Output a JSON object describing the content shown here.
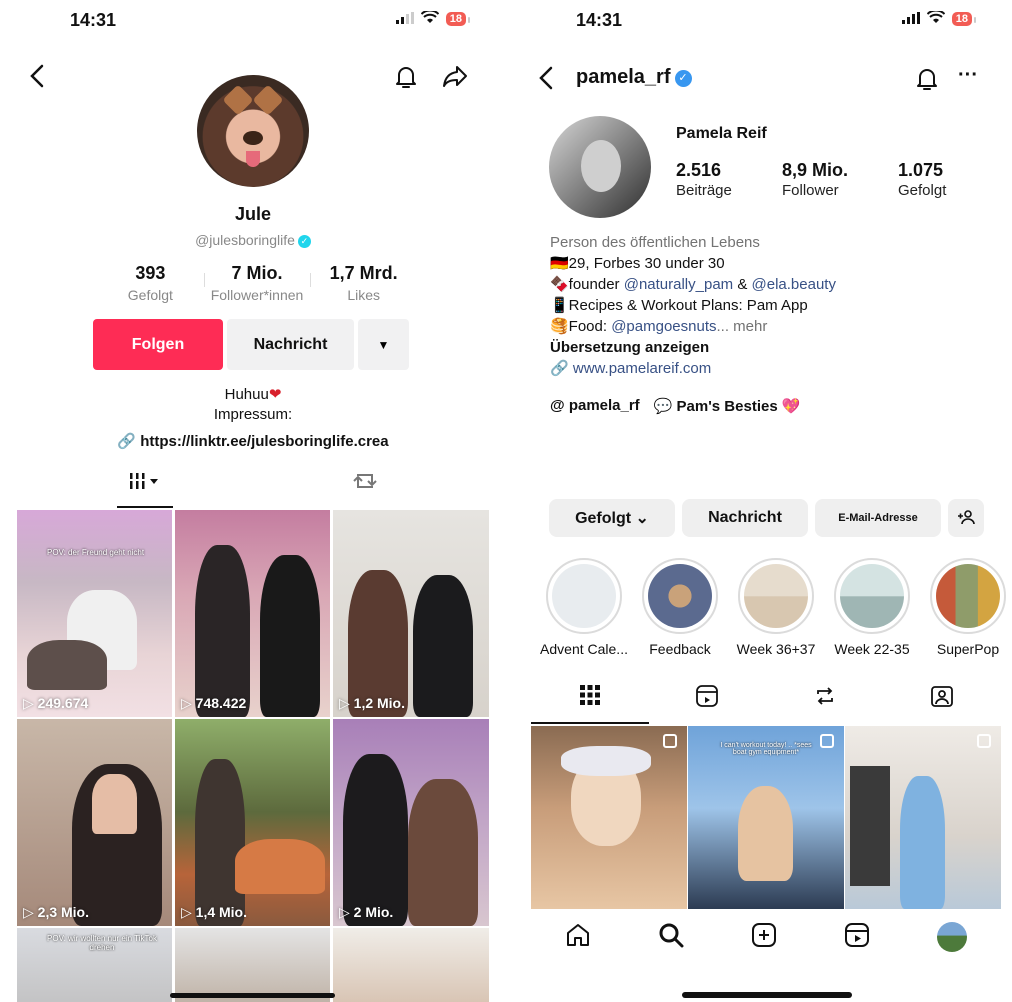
{
  "status_left": {
    "time": "14:31",
    "battery": "18"
  },
  "status_right": {
    "time": "14:31",
    "battery": "18"
  },
  "tiktok": {
    "name": "Jule",
    "handle": "@julesboringlife",
    "stats": [
      {
        "value": "393",
        "label": "Gefolgt"
      },
      {
        "value": "7 Mio.",
        "label": "Follower*innen"
      },
      {
        "value": "1,7 Mrd.",
        "label": "Likes"
      }
    ],
    "follow_label": "Folgen",
    "message_label": "Nachricht",
    "bio_line1": "Huhuu",
    "bio_line2": "Impressum:",
    "link": "https://linktr.ee/julesboringlife.crea",
    "videos": [
      {
        "views": "249.674",
        "caption": "POV: der Freund geht nicht"
      },
      {
        "views": "748.422"
      },
      {
        "views": "1,2 Mio."
      },
      {
        "views": "2,3 Mio."
      },
      {
        "views": "1,4 Mio."
      },
      {
        "views": "2 Mio."
      },
      {
        "views": "",
        "caption": "POV: wir wollten nur ein TikTok drehen"
      },
      {
        "views": ""
      },
      {
        "views": ""
      }
    ],
    "accent": "#fe2c55"
  },
  "instagram": {
    "username": "pamela_rf",
    "full_name": "Pamela Reif",
    "stats": [
      {
        "value": "2.516",
        "label": "Beiträge"
      },
      {
        "value": "8,9 Mio.",
        "label": "Follower"
      },
      {
        "value": "1.075",
        "label": "Gefolgt"
      }
    ],
    "bio": {
      "category": "Person des öffentlichen Lebens",
      "line1": "🇩🇪29, Forbes 30 under 30",
      "line2_prefix": "🍫founder ",
      "line2_mention1": "@naturally_pam",
      "line2_and": " & ",
      "line2_mention2": "@ela.beauty",
      "line3": "📱Recipes & Workout Plans: Pam App",
      "line4_prefix": "🥞Food: ",
      "line4_mention": "@pamgoesnuts",
      "line4_more": "... mehr",
      "translate": "Übersetzung anzeigen",
      "url": "www.pamelareif.com"
    },
    "threads_handle": "pamela_rf",
    "channel_name": "Pam's Besties",
    "buttons": {
      "following": "Gefolgt",
      "message": "Nachricht",
      "email": "E-Mail-Adresse",
      "add_user": "+&"
    },
    "highlights": [
      {
        "label": "Advent Cale...",
        "color": "#e8ecef"
      },
      {
        "label": "Feedback",
        "color": "#5b6a8f"
      },
      {
        "label": "Week 36+37",
        "color": "#d8c7b0"
      },
      {
        "label": "Week 22-35",
        "color": "#9fb6b4"
      },
      {
        "label": "SuperPop",
        "color": "#8f9c6a"
      }
    ],
    "grid": [
      {
        "caption": ""
      },
      {
        "caption": "I can't workout today! .. *sees boat gym equipment*"
      },
      {
        "caption": ""
      }
    ],
    "accent": "#3897f0"
  }
}
